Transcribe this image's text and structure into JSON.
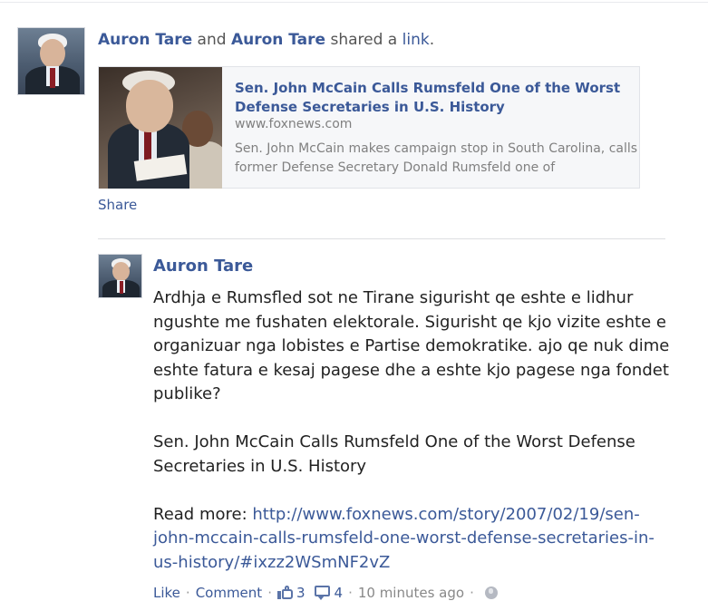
{
  "story": {
    "actor1": "Auron Tare",
    "conj": "and",
    "actor2": "Auron Tare",
    "verb": "shared a",
    "object": "link",
    "period": "."
  },
  "attachment": {
    "title": "Sen. John McCain Calls Rumsfeld One of the Worst Defense Secretaries in U.S. History",
    "domain": "www.foxnews.com",
    "description": "Sen. John McCain makes campaign stop in South Carolina, calls former Defense Secretary Donald Rumsfeld one of"
  },
  "share_label": "Share",
  "comment": {
    "author": "Auron Tare",
    "paragraph1": "Ardhja e Rumsfled sot ne Tirane sigurisht qe eshte e lidhur ngushte me fushaten elektorale. Sigurisht qe kjo vizite eshte e organizuar nga lobistes e Partise demokratike. ajo qe nuk dime eshte fatura e kesaj pagese dhe a eshte kjo pagese nga fondet publike?",
    "paragraph2": "Sen. John McCain Calls Rumsfeld One of the Worst Defense Secretaries in U.S. History",
    "read_more_label": "Read more:",
    "read_more_url": "http://www.foxnews.com/story/2007/02/19/sen-john-mccain-calls-rumsfeld-one-worst-defense-secretaries-in-us-history/#ixzz2WSmNF2vZ"
  },
  "actions": {
    "like": "Like",
    "comment": "Comment",
    "like_count": "3",
    "comment_count": "4",
    "timestamp": "10 minutes ago",
    "separator": "·"
  },
  "icons": {
    "like": "thumbs-up-icon",
    "comment": "comment-icon",
    "privacy": "globe-icon"
  },
  "colors": {
    "link": "#3b5998",
    "muted": "#808080"
  }
}
